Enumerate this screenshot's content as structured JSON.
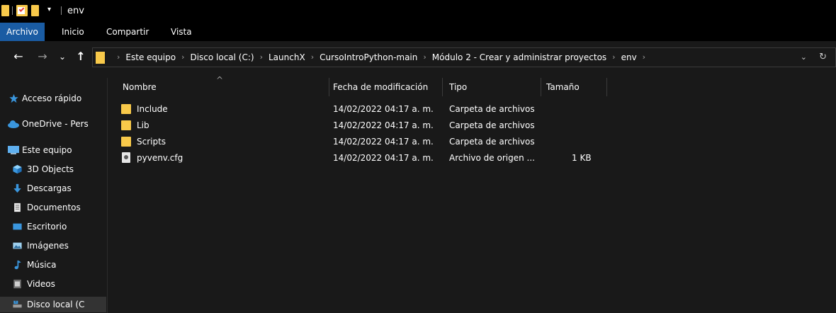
{
  "window": {
    "title": "env"
  },
  "quick_access": {
    "dropdown_glyph": "▾"
  },
  "ribbon": {
    "tabs": [
      {
        "label": "Archivo",
        "active": true
      },
      {
        "label": "Inicio"
      },
      {
        "label": "Compartir"
      },
      {
        "label": "Vista"
      }
    ]
  },
  "nav_buttons": {
    "back": "←",
    "forward": "→",
    "recent": "⌄",
    "up": "↑"
  },
  "address": {
    "crumbs": [
      "Este equipo",
      "Disco local (C:)",
      "LaunchX",
      "CursoIntroPython-main",
      "Módulo 2 - Crear y administrar proyectos",
      "env"
    ],
    "separator": "›",
    "dropdown_glyph": "⌄",
    "refresh_glyph": "↻"
  },
  "sidebar": {
    "items": [
      {
        "label": "Acceso rápido",
        "icon": "star-icon"
      },
      {
        "label": "OneDrive - Pers",
        "icon": "cloud-icon"
      },
      {
        "label": "Este equipo",
        "icon": "computer-icon"
      },
      {
        "label": "3D Objects",
        "icon": "cube-icon"
      },
      {
        "label": "Descargas",
        "icon": "download-icon"
      },
      {
        "label": "Documentos",
        "icon": "document-icon"
      },
      {
        "label": "Escritorio",
        "icon": "desktop-icon"
      },
      {
        "label": "Imágenes",
        "icon": "pictures-icon"
      },
      {
        "label": "Música",
        "icon": "music-icon"
      },
      {
        "label": "Videos",
        "icon": "video-icon"
      },
      {
        "label": "Disco local (C",
        "icon": "drive-icon",
        "selected": true
      }
    ]
  },
  "columns": {
    "name": "Nombre",
    "modified": "Fecha de modificación",
    "type": "Tipo",
    "size": "Tamaño",
    "sort_glyph": "^"
  },
  "files": [
    {
      "name": "Include",
      "modified": "14/02/2022 04:17 a. m.",
      "type": "Carpeta de archivos",
      "size": "",
      "icon": "folder-icon"
    },
    {
      "name": "Lib",
      "modified": "14/02/2022 04:17 a. m.",
      "type": "Carpeta de archivos",
      "size": "",
      "icon": "folder-icon"
    },
    {
      "name": "Scripts",
      "modified": "14/02/2022 04:17 a. m.",
      "type": "Carpeta de archivos",
      "size": "",
      "icon": "folder-icon"
    },
    {
      "name": "pyvenv.cfg",
      "modified": "14/02/2022 04:17 a. m.",
      "type": "Archivo de origen ...",
      "size": "1 KB",
      "icon": "config-file-icon"
    }
  ],
  "colors": {
    "accent": "#1a5ca3",
    "folder": "#f8c94a",
    "background": "#191919",
    "titlebar": "#000000"
  }
}
